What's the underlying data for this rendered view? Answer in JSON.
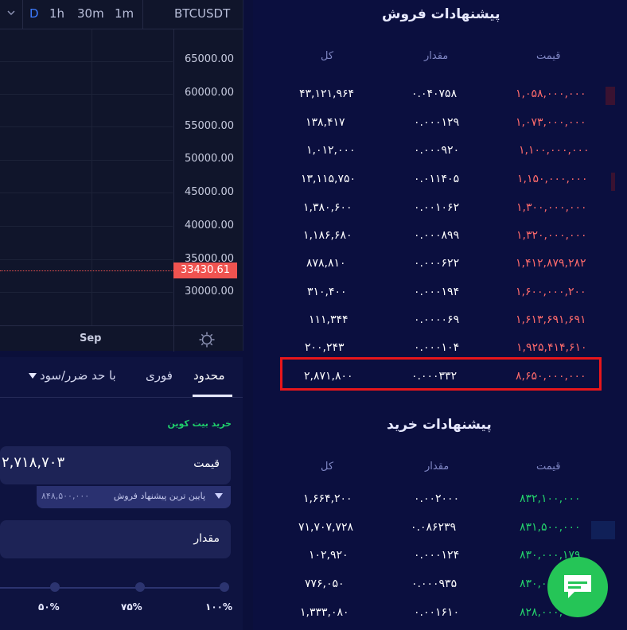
{
  "toolbar": {
    "intervals": [
      "D",
      "1h",
      "30m",
      "1m"
    ],
    "symbol": "BTCUSDT"
  },
  "chart": {
    "price_ticks": [
      "65000.00",
      "60000.00",
      "55000.00",
      "50000.00",
      "45000.00",
      "40000.00",
      "35000.00",
      "30000.00"
    ],
    "last_price": "33430.61",
    "time_label": "Sep"
  },
  "trade": {
    "tabs": {
      "limit": "محدود",
      "market": "فوری",
      "stop": "با حد ضرر/سود"
    },
    "buy_title": "خرید بیت کوین",
    "price_label": "قیمت",
    "price_value": "۲,۷۱۸,۷۰۳",
    "hint": "پایین ترین پیشنهاد فروش",
    "hint_value": "۸۴۸,۵۰۰,۰۰۰",
    "qty_label": "مقدار",
    "percents": [
      "۵۰%",
      "۷۵%",
      "۱۰۰%"
    ]
  },
  "sell": {
    "title": "پیشنهادات فروش",
    "headers": {
      "price": "قیمت",
      "amount": "مقدار",
      "total": "کل"
    },
    "rows": [
      {
        "price": "۱,۰۵۸,۰۰۰,۰۰۰",
        "amount": "۰.۰۴۰۷۵۸",
        "total": "۴۳,۱۲۱,۹۶۴"
      },
      {
        "price": "۱,۰۷۳,۰۰۰,۰۰۰",
        "amount": "۰.۰۰۰۱۲۹",
        "total": "۱۳۸,۴۱۷"
      },
      {
        "price": "۱,۱۰۰,۰۰۰,۰۰۰",
        "amount": "۰.۰۰۰۹۲۰",
        "total": "۱,۰۱۲,۰۰۰"
      },
      {
        "price": "۱,۱۵۰,۰۰۰,۰۰۰",
        "amount": "۰.۰۱۱۴۰۵",
        "total": "۱۳,۱۱۵,۷۵۰"
      },
      {
        "price": "۱,۳۰۰,۰۰۰,۰۰۰",
        "amount": "۰.۰۰۱۰۶۲",
        "total": "۱,۳۸۰,۶۰۰"
      },
      {
        "price": "۱,۳۲۰,۰۰۰,۰۰۰",
        "amount": "۰.۰۰۰۸۹۹",
        "total": "۱,۱۸۶,۶۸۰"
      },
      {
        "price": "۱,۴۱۲,۸۷۹,۲۸۲",
        "amount": "۰.۰۰۰۶۲۲",
        "total": "۸۷۸,۸۱۰"
      },
      {
        "price": "۱,۶۰۰,۰۰۰,۲۰۰",
        "amount": "۰.۰۰۰۱۹۴",
        "total": "۳۱۰,۴۰۰"
      },
      {
        "price": "۱,۶۱۳,۶۹۱,۶۹۱",
        "amount": "۰.۰۰۰۰۶۹",
        "total": "۱۱۱,۳۴۴"
      },
      {
        "price": "۱,۹۲۵,۴۱۴,۶۱۰",
        "amount": "۰.۰۰۰۱۰۴",
        "total": "۲۰۰,۲۴۳"
      },
      {
        "price": "۸,۶۵۰,۰۰۰,۰۰۰",
        "amount": "۰.۰۰۰۳۳۲",
        "total": "۲,۸۷۱,۸۰۰"
      }
    ]
  },
  "buy": {
    "title": "پیشنهادات خرید",
    "headers": {
      "price": "قیمت",
      "amount": "مقدار",
      "total": "کل"
    },
    "rows": [
      {
        "price": "۸۳۲,۱۰۰,۰۰۰",
        "amount": "۰.۰۰۲۰۰۰",
        "total": "۱,۶۶۴,۲۰۰"
      },
      {
        "price": "۸۳۱,۵۰۰,۰۰۰",
        "amount": "۰.۰۸۶۲۳۹",
        "total": "۷۱,۷۰۷,۷۲۸"
      },
      {
        "price": "۸۳۰,۰۰۰,۱۷۹",
        "amount": "۰.۰۰۰۱۲۴",
        "total": "۱۰۲,۹۲۰"
      },
      {
        "price": "۸۳۰,۰۰۰,۰۰۰",
        "amount": "۰.۰۰۰۹۳۵",
        "total": "۷۷۶,۰۵۰"
      },
      {
        "price": "۸۲۸,۰۰۰,۰۰۰",
        "amount": "۰.۰۰۱۶۱۰",
        "total": "۱,۳۳۳,۰۸۰"
      }
    ]
  },
  "colors": {
    "sell": "#ff6b6b",
    "buy": "#24d36c",
    "highlight": "#e8161b",
    "chat": "#25c557"
  }
}
